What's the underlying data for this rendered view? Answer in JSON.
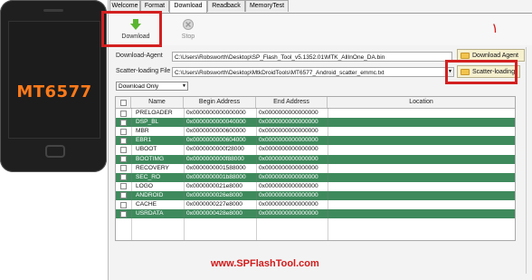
{
  "phone": {
    "brand": "MT6577"
  },
  "tabs": [
    {
      "label": "Welcome"
    },
    {
      "label": "Format"
    },
    {
      "label": "Download"
    },
    {
      "label": "Readback"
    },
    {
      "label": "MemoryTest"
    }
  ],
  "active_tab": "Download",
  "toolbar": {
    "download_label": "Download",
    "stop_label": "Stop"
  },
  "download_agent": {
    "label": "Download-Agent",
    "path": "C:\\Users\\Robsworth\\Desktop\\SP_Flash_Tool_v5.1352.01\\MTK_AllInOne_DA.bin",
    "button": "Download Agent"
  },
  "scatter": {
    "label": "Scatter-loading File",
    "path": "C:\\Users\\Robsworth\\Desktop\\MtkDroidTools\\MT6577_Android_scatter_emmc.txt",
    "button": "Scatter-loading"
  },
  "mode_select": {
    "value": "Download Only"
  },
  "table": {
    "headers": [
      "Name",
      "Begin Address",
      "End Address",
      "Location"
    ],
    "rows": [
      {
        "name": "PRELOADER",
        "begin": "0x0000000000000000",
        "end": "0x0000000000000000",
        "location": "",
        "style": "w"
      },
      {
        "name": "DSP_BL",
        "begin": "0x0000000000040000",
        "end": "0x0000000000000000",
        "location": "",
        "style": "g"
      },
      {
        "name": "MBR",
        "begin": "0x0000000000600000",
        "end": "0x0000000000000000",
        "location": "",
        "style": "w"
      },
      {
        "name": "EBR1",
        "begin": "0x0000000000604000",
        "end": "0x0000000000000000",
        "location": "",
        "style": "g"
      },
      {
        "name": "UBOOT",
        "begin": "0x0000000000f28000",
        "end": "0x0000000000000000",
        "location": "",
        "style": "w"
      },
      {
        "name": "BOOTIMG",
        "begin": "0x0000000000f88000",
        "end": "0x0000000000000000",
        "location": "",
        "style": "g"
      },
      {
        "name": "RECOVERY",
        "begin": "0x0000000001588000",
        "end": "0x0000000000000000",
        "location": "",
        "style": "w"
      },
      {
        "name": "SEC_RO",
        "begin": "0x0000000001b88000",
        "end": "0x0000000000000000",
        "location": "",
        "style": "g"
      },
      {
        "name": "LOGO",
        "begin": "0x0000000021e8000",
        "end": "0x0000000000000000",
        "location": "",
        "style": "w"
      },
      {
        "name": "ANDROID",
        "begin": "0x0000000026e8000",
        "end": "0x0000000000000000",
        "location": "",
        "style": "g"
      },
      {
        "name": "CACHE",
        "begin": "0x0000000227e8000",
        "end": "0x0000000000000000",
        "location": "",
        "style": "w"
      },
      {
        "name": "USRDATA",
        "begin": "0x0000000428e8000",
        "end": "0x0000000000000000",
        "location": "",
        "style": "g"
      }
    ]
  },
  "annotation_mark": "١",
  "website": "www.SPFlashTool.com",
  "colors": {
    "highlight": "#d32020",
    "row_green": "#3f8a5d",
    "brand_orange": "#ff7a1a"
  }
}
